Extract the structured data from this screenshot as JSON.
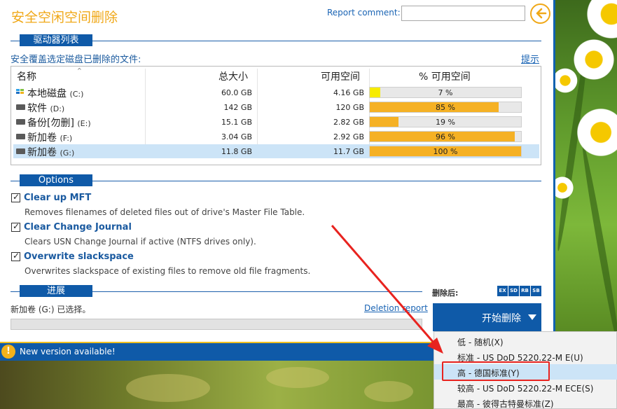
{
  "app": {
    "title": "安全空闲空间删除"
  },
  "report": {
    "label": "Report comment:",
    "value": ""
  },
  "drives_section": {
    "tag": "驱动器列表",
    "caption": "安全覆盖选定磁盘已删除的文件:",
    "hint_link": "提示"
  },
  "table": {
    "headers": {
      "name": "名称",
      "total": "总大小",
      "free": "可用空间",
      "pct": "% 可用空间"
    },
    "rows": [
      {
        "name": "本地磁盘",
        "letter": "(C:)",
        "total": "60.0 GB",
        "free": "4.16 GB",
        "pct_label": "7 %",
        "pct": 7,
        "icon": "system-drive-icon",
        "selected": false
      },
      {
        "name": "软件",
        "letter": "(D:)",
        "total": "142 GB",
        "free": "120 GB",
        "pct_label": "85 %",
        "pct": 85,
        "icon": "drive-icon",
        "selected": false
      },
      {
        "name": "备份[勿删]",
        "letter": "(E:)",
        "total": "15.1 GB",
        "free": "2.82 GB",
        "pct_label": "19 %",
        "pct": 19,
        "icon": "drive-icon",
        "selected": false
      },
      {
        "name": "新加卷",
        "letter": "(F:)",
        "total": "3.04 GB",
        "free": "2.92 GB",
        "pct_label": "96 %",
        "pct": 96,
        "icon": "drive-icon",
        "selected": false
      },
      {
        "name": "新加卷",
        "letter": "(G:)",
        "total": "11.8 GB",
        "free": "11.7 GB",
        "pct_label": "100 %",
        "pct": 100,
        "icon": "drive-icon",
        "selected": true
      }
    ]
  },
  "options_section": {
    "tag": "Options",
    "items": [
      {
        "title": "Clear up MFT",
        "desc": "Removes filenames of deleted files out of drive's Master File Table.",
        "checked": true
      },
      {
        "title": "Clear Change Journal",
        "desc": "Clears USN Change Journal if active (NTFS drives only).",
        "checked": true
      },
      {
        "title": "Overwrite slackspace",
        "desc": "Overwrites slackspace of existing files to remove old file fragments.",
        "checked": true
      }
    ]
  },
  "progress_section": {
    "tag": "进展",
    "status": "新加卷 (G:) 已选择。",
    "report_link": "Deletion report",
    "progress": 0
  },
  "after_delete": {
    "label": "删除后:",
    "badges": [
      "EX",
      "SD",
      "RB",
      "SB"
    ]
  },
  "start_button": {
    "label": "开始删除"
  },
  "notification": {
    "message": "New version available!"
  },
  "dropdown": {
    "items": [
      {
        "label": "低 - 随机(X)",
        "highlighted": false
      },
      {
        "label": "标准 - US DoD 5220.22-M E(U)",
        "highlighted": false
      },
      {
        "label": "高 - 德国标准(Y)",
        "highlighted": true
      },
      {
        "label": "较高 - US DoD 5220.22-M ECE(S)",
        "highlighted": false
      },
      {
        "label": "最高 - 彼得古特曼标准(Z)",
        "highlighted": false
      }
    ]
  },
  "colors": {
    "accent_blue": "#0f5aa8",
    "title_orange": "#f0a818",
    "bar_fill": "#f5b125",
    "bar_low": "#f7ec00",
    "annotation_red": "#e8231f"
  }
}
